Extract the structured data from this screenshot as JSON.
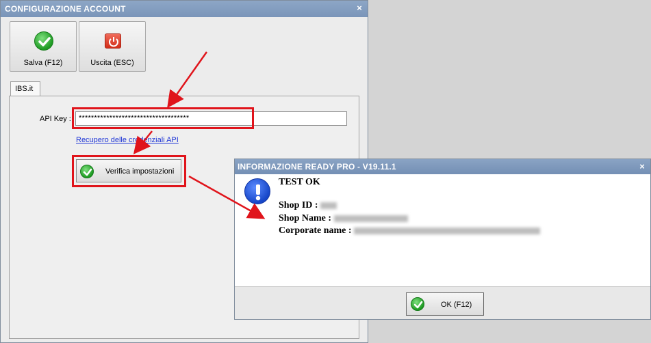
{
  "main_window": {
    "title": "CONFIGURAZIONE ACCOUNT",
    "close_glyph": "×",
    "toolbar": {
      "save_label": "Salva (F12)",
      "save_icon": "checkmark-green-icon",
      "exit_label": "Uscita (ESC)",
      "exit_icon": "power-red-icon"
    },
    "tab_label": "IBS.it",
    "api_key": {
      "label": "API Key :",
      "value": "************************************"
    },
    "link_text": "Recupero delle credenziali API",
    "verify_button_label": "Verifica impostazioni"
  },
  "dialog": {
    "title": "INFORMAZIONE READY PRO - V19.11.1",
    "close_glyph": "×",
    "icon": "exclamation-info-icon",
    "heading": "TEST OK",
    "shop_id_label": "Shop ID :",
    "shop_name_label": "Shop Name :",
    "corporate_label": "Corporate name :",
    "ok_label": "OK (F12)"
  },
  "colors": {
    "highlight_red": "#e0141b",
    "titlebar_blue": "#7a95b9",
    "link_blue": "#1f36d6"
  }
}
